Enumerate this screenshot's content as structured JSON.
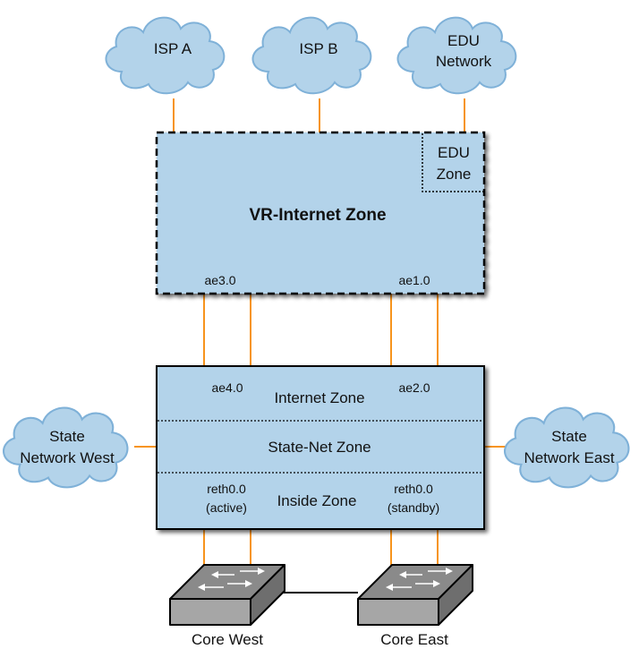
{
  "diagram": {
    "clouds": {
      "isp_a": {
        "lines": [
          "ISP A"
        ]
      },
      "isp_b": {
        "lines": [
          "ISP B"
        ]
      },
      "edu": {
        "lines": [
          "EDU",
          "Network"
        ]
      },
      "state_west": {
        "lines": [
          "State",
          "Network West"
        ]
      },
      "state_east": {
        "lines": [
          "State",
          "Network East"
        ]
      }
    },
    "vr_box": {
      "title": "VR-Internet Zone",
      "edu_zone": [
        "EDU",
        "Zone"
      ],
      "left_iface": "ae3.0",
      "right_iface": "ae1.0"
    },
    "fw_box": {
      "internet_zone": "Internet Zone",
      "state_net_zone": "State-Net Zone",
      "inside_zone": "Inside Zone",
      "left_top_iface": "ae4.0",
      "right_top_iface": "ae2.0",
      "left_reth": [
        "reth0.0",
        "(active)"
      ],
      "right_reth": [
        "reth0.0",
        "(standby)"
      ]
    },
    "switches": {
      "west": "Core West",
      "east": "Core East"
    },
    "colors": {
      "cloud_fill": "#b3d3ea",
      "cloud_stroke": "#7fb1d8",
      "box_fill": "#b3d3ea",
      "link": "#f7941d",
      "switch_top": "#8a8a8a",
      "switch_front": "#a6a6a6",
      "switch_side": "#6e6e6e"
    }
  }
}
